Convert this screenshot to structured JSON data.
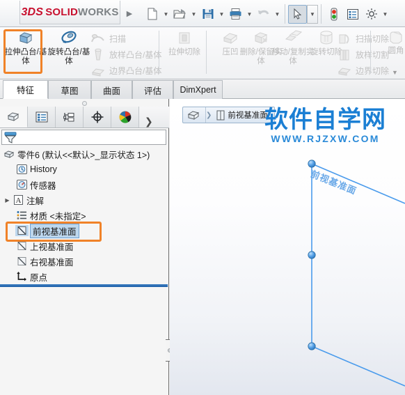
{
  "app": {
    "brand_3ds": "3DS",
    "brand_solid": "SOLID",
    "brand_works": "WORKS",
    "accent_orange": "#f08228",
    "accent_blue": "#1b7fd4",
    "selection_blue": "#bdd7ee"
  },
  "quick_toolbar": {
    "items": [
      {
        "name": "new-document",
        "icon": "new-file-icon",
        "caret": true
      },
      {
        "name": "open-document",
        "icon": "open-folder-icon",
        "caret": true
      },
      {
        "name": "save-document",
        "icon": "save-disk-icon",
        "caret": true
      },
      {
        "name": "print-document",
        "icon": "printer-icon",
        "caret": true
      },
      {
        "name": "undo",
        "icon": "undo-arrow-icon",
        "caret": true
      },
      {
        "name": "select",
        "icon": "cursor-arrow-icon",
        "caret": true,
        "selected": true
      },
      {
        "name": "rebuild",
        "icon": "traffic-light-icon",
        "caret": false
      },
      {
        "name": "options-list",
        "icon": "list-properties-icon",
        "caret": false
      },
      {
        "name": "options",
        "icon": "gear-icon",
        "caret": true
      }
    ]
  },
  "ribbon": {
    "big_buttons": [
      {
        "label": "拉伸凸台/基体",
        "icon": "extrude-boss-icon",
        "dim": false,
        "highlighted": true
      },
      {
        "label": "旋转凸台/基体",
        "icon": "revolve-boss-icon",
        "dim": false
      },
      {
        "label": "拉伸切除",
        "icon": "extrude-cut-icon",
        "dim": true
      },
      {
        "label": "压凹",
        "icon": "indent-icon",
        "dim": true
      },
      {
        "label": "删除/保留实体",
        "icon": "delete-body-icon",
        "dim": true
      },
      {
        "label": "移动/复制实体",
        "icon": "move-copy-body-icon",
        "dim": true
      },
      {
        "label": "旋转切除",
        "icon": "revolve-cut-icon",
        "dim": true
      },
      {
        "label": "圆角",
        "icon": "fillet-icon",
        "dim": true
      }
    ],
    "small_buttons_group1": [
      {
        "label": "扫描",
        "icon": "sweep-icon"
      },
      {
        "label": "放样凸台/基体",
        "icon": "loft-boss-icon"
      },
      {
        "label": "边界凸台/基体",
        "icon": "boundary-boss-icon"
      }
    ],
    "small_buttons_group2": [
      {
        "label": "扫描切除",
        "icon": "sweep-cut-icon"
      },
      {
        "label": "放样切割",
        "icon": "loft-cut-icon"
      },
      {
        "label": "边界切除",
        "icon": "boundary-cut-icon"
      }
    ],
    "overflow_label": "▼"
  },
  "tabs": [
    {
      "label": "特征",
      "active": true
    },
    {
      "label": "草图",
      "active": false
    },
    {
      "label": "曲面",
      "active": false
    },
    {
      "label": "评估",
      "active": false
    },
    {
      "label": "DimXpert",
      "active": false
    }
  ],
  "feature_manager": {
    "panel_tabs": [
      {
        "name": "feature-tree-tab",
        "icon": "feature-tree-icon",
        "active": true
      },
      {
        "name": "property-manager-tab",
        "icon": "property-list-icon",
        "active": false
      },
      {
        "name": "configuration-manager-tab",
        "icon": "configuration-icon",
        "active": false
      },
      {
        "name": "dimxpert-manager-tab",
        "icon": "crosshair-icon",
        "active": false
      },
      {
        "name": "display-manager-tab",
        "icon": "color-sphere-icon",
        "active": false
      }
    ],
    "more_tabs_label": "❯",
    "filter": {
      "placeholder": "",
      "value": "",
      "icon": "filter-funnel-icon"
    },
    "tree": [
      {
        "label": "零件6  (默认<<默认>_显示状态 1>)",
        "icon": "part-icon",
        "indent": 0,
        "expander": "",
        "selected": false
      },
      {
        "label": "History",
        "icon": "history-icon",
        "indent": 1,
        "expander": "",
        "selected": false
      },
      {
        "label": "传感器",
        "icon": "sensor-icon",
        "indent": 1,
        "expander": "",
        "selected": false
      },
      {
        "label": "注解",
        "icon": "annotations-icon",
        "indent": 1,
        "expander": "▶",
        "selected": false
      },
      {
        "label": "材质 <未指定>",
        "icon": "material-icon",
        "indent": 1,
        "expander": "",
        "selected": false
      },
      {
        "label": "前视基准面",
        "icon": "plane-icon",
        "indent": 1,
        "expander": "",
        "selected": true
      },
      {
        "label": "上视基准面",
        "icon": "plane-icon",
        "indent": 1,
        "expander": "",
        "selected": false
      },
      {
        "label": "右视基准面",
        "icon": "plane-icon",
        "indent": 1,
        "expander": "",
        "selected": false
      },
      {
        "label": "原点",
        "icon": "origin-icon",
        "indent": 1,
        "expander": "",
        "selected": false
      }
    ]
  },
  "graphics": {
    "breadcrumb": {
      "root_icon": "part-icon",
      "item_icon": "plane-icon",
      "item_label": "前视基准面"
    },
    "watermark": {
      "main": "软件自学网",
      "sub": "WWW.RJZXW.COM"
    },
    "plane": {
      "label": "前视基准面",
      "line_color": "#4a9bec",
      "handle_color": "#3f92e0"
    }
  }
}
